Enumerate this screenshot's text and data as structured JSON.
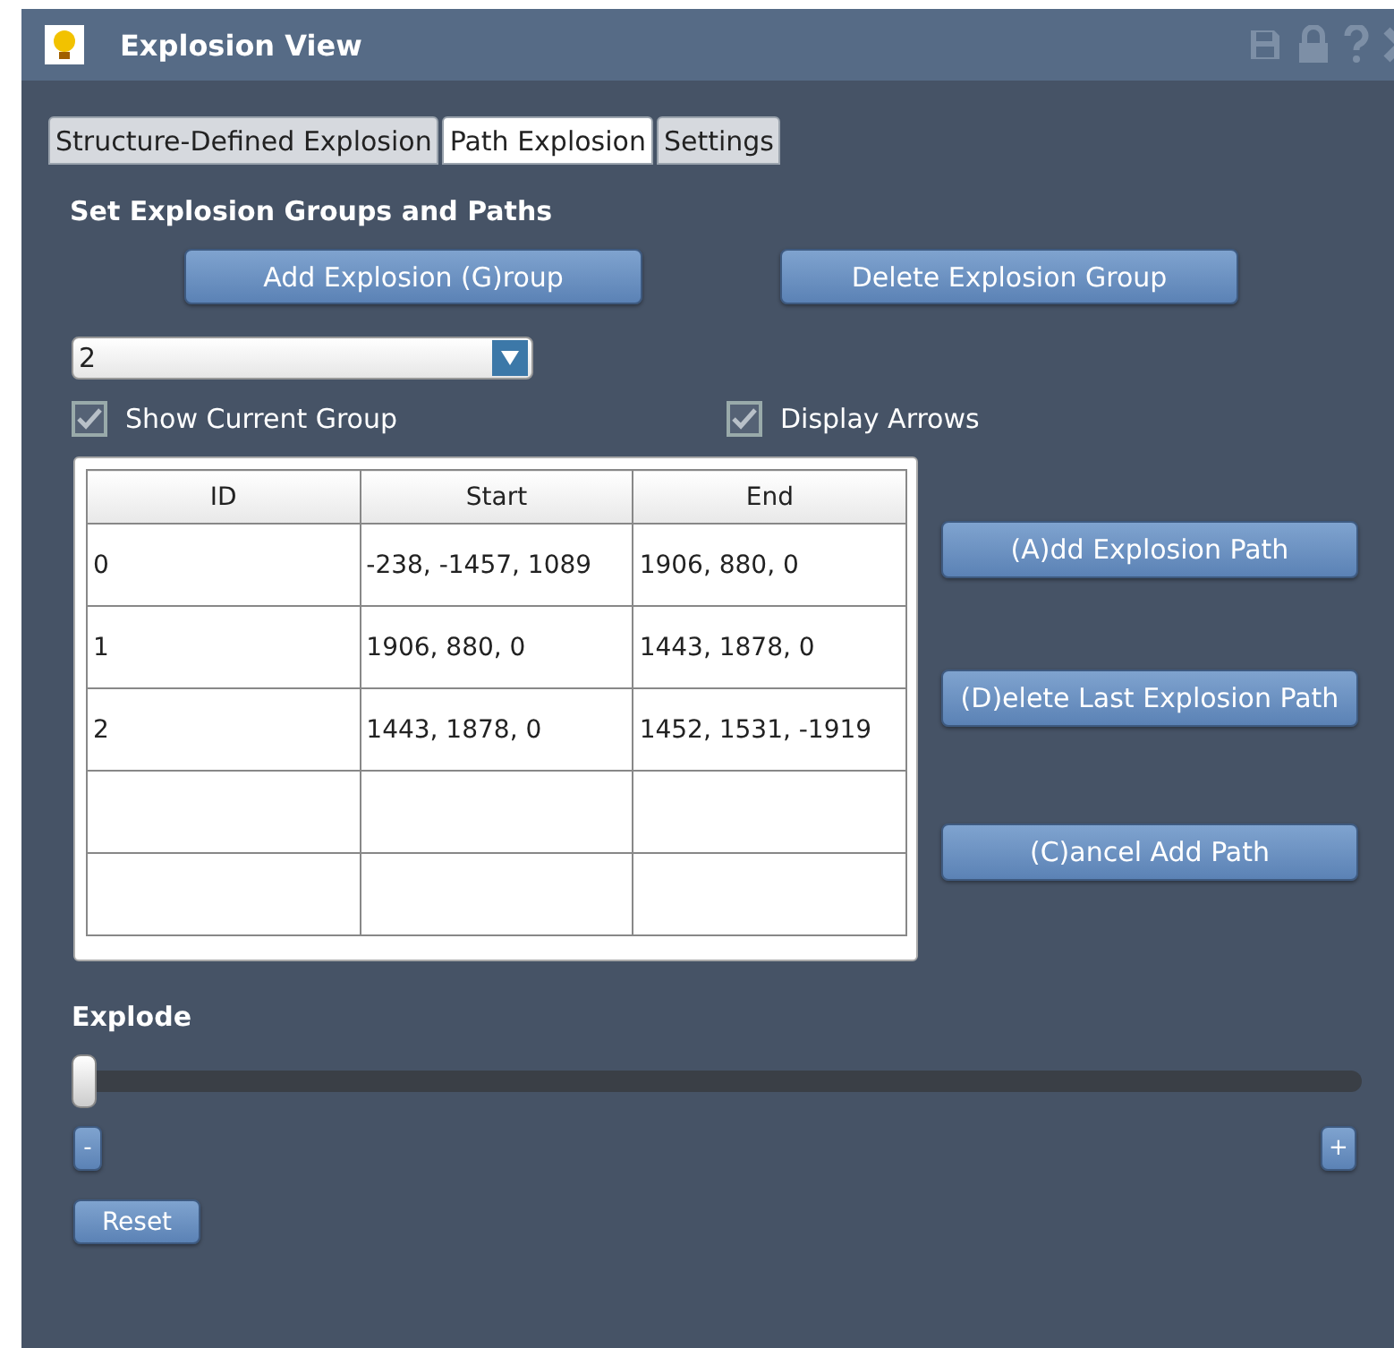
{
  "window": {
    "title": "Explosion View"
  },
  "tabs": [
    {
      "label": "Structure-Defined Explosion",
      "selected": false
    },
    {
      "label": "Path Explosion",
      "selected": true
    },
    {
      "label": "Settings",
      "selected": false
    }
  ],
  "section_title": "Set Explosion Groups and Paths",
  "group_buttons": [
    "Add Explosion (G)roup",
    "Delete Explosion Group"
  ],
  "group_select": {
    "value": "2"
  },
  "checkboxes": [
    {
      "label": "Show Current Group",
      "checked": true
    },
    {
      "label": "Display Arrows",
      "checked": true
    }
  ],
  "table": {
    "columns": [
      "ID",
      "Start",
      "End"
    ],
    "rows": [
      [
        "0",
        "-238, -1457, 1089",
        "1906, 880, 0"
      ],
      [
        "1",
        "1906, 880, 0",
        "1443, 1878, 0"
      ],
      [
        "2",
        "1443, 1878, 0",
        "1452, 1531, -1919"
      ]
    ]
  },
  "path_buttons": [
    "(A)dd Explosion Path",
    "(D)elete Last Explosion Path",
    "(C)ancel Add Path"
  ],
  "explode": {
    "label": "Explode",
    "level": 0,
    "decrease": "-",
    "increase": "+",
    "reset": "Reset"
  }
}
